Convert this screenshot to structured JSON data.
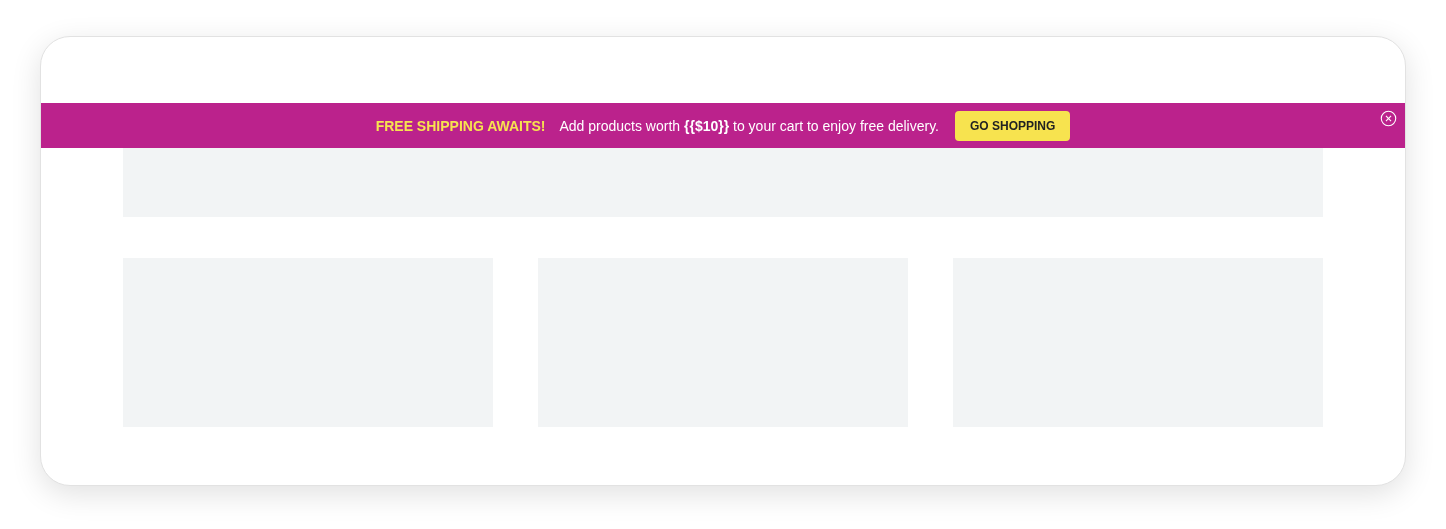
{
  "banner": {
    "headline": "FREE SHIPPING AWAITS!",
    "message": "Add products worth **{{$10}}** to your cart to enjoy free delivery.",
    "button": "GO SHOPPING"
  },
  "content": {
    "hero": {
      "kind": "placeholder"
    },
    "cards": [
      {
        "kind": "placeholder"
      },
      {
        "kind": "placeholder"
      },
      {
        "kind": "placeholder"
      }
    ]
  }
}
